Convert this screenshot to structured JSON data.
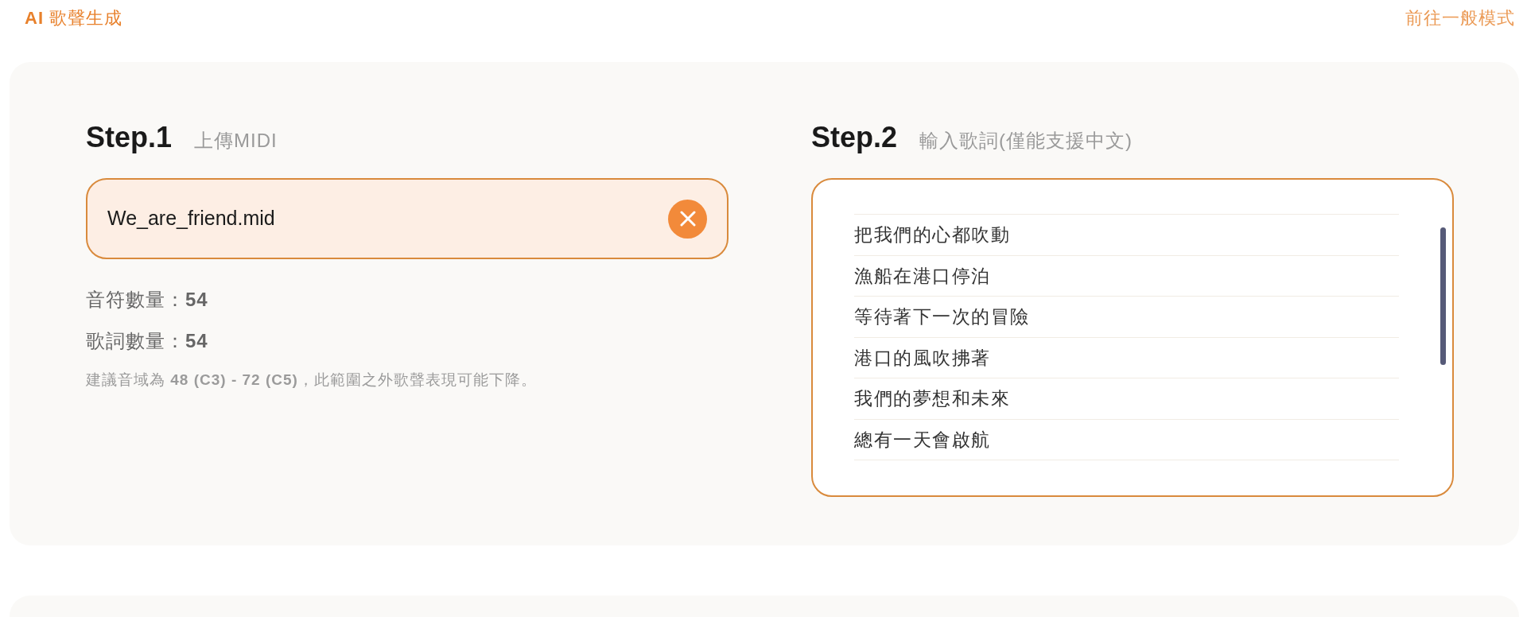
{
  "header": {
    "title": "**AI** 歌聲生成",
    "mode_link": "前往一般模式"
  },
  "step1": {
    "step": "Step.1",
    "label": "上傳MIDI",
    "file": {
      "name": "We_are_friend.mid"
    },
    "stats": [
      "音符數量：**54**",
      "歌詞數量：**54**"
    ],
    "note": "建議音域為 **48 (C3) - 72 (C5)**，此範圍之外歌聲表現可能下降。"
  },
  "step2": {
    "step": "Step.2",
    "label": "輸入歌詞(僅能支援中文)",
    "lyrics": [
      "把我們的心都吹動",
      "漁船在港口停泊",
      "等待著下一次的冒險",
      "港口的風吹拂著",
      "我們的夢想和未來",
      "總有一天會啟航"
    ]
  }
}
